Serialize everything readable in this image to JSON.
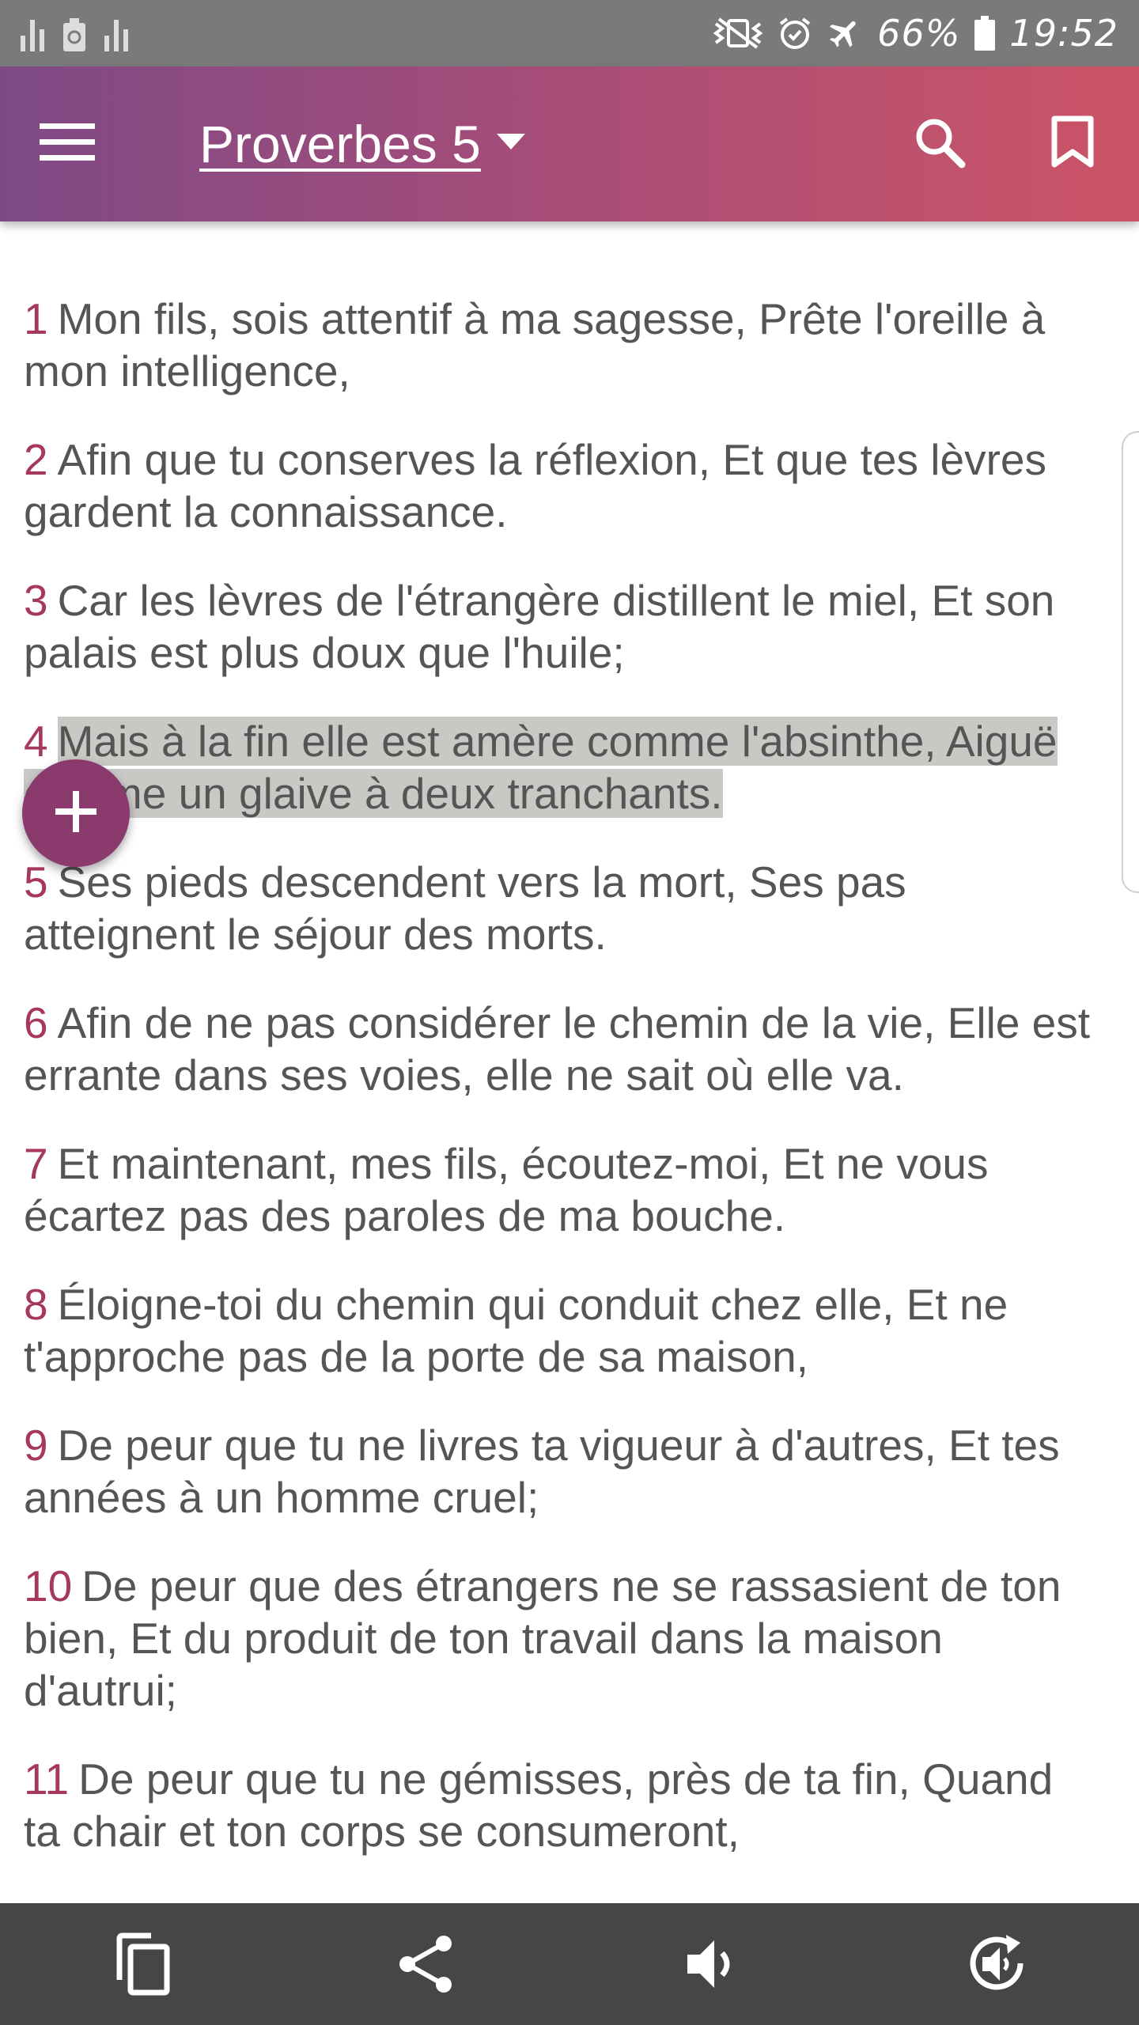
{
  "status_bar": {
    "battery_percent": "66%",
    "time": "19:52",
    "icons": [
      "signal-icon",
      "recycle-icon",
      "signal-icon",
      "vibrate-icon",
      "alarm-icon",
      "airplane-mode-icon",
      "battery-icon"
    ]
  },
  "app_bar": {
    "title": "Proverbes 5",
    "icons": [
      "menu-icon",
      "dropdown-arrow-icon",
      "search-icon",
      "bookmark-icon"
    ]
  },
  "verses": [
    {
      "number": "1",
      "text": "Mon fils, sois attentif à ma sagesse, Prête l'oreille à mon intelligence,"
    },
    {
      "number": "2",
      "text": "Afin que tu conserves la réflexion, Et que tes lèvres gardent la connaissance."
    },
    {
      "number": "3",
      "text": "Car les lèvres de l'étrangère distillent le miel, Et son palais est plus doux que l'huile;"
    },
    {
      "number": "4",
      "text": "Mais à la fin elle est amère comme l'absinthe, Aiguë comme un glaive à deux tranchants.",
      "highlighted": true
    },
    {
      "number": "5",
      "text": "Ses pieds descendent vers la mort, Ses pas atteignent le séjour des morts."
    },
    {
      "number": "6",
      "text": "Afin de ne pas considérer le chemin de la vie, Elle est errante dans ses voies, elle ne sait où elle va."
    },
    {
      "number": "7",
      "text": "Et maintenant, mes fils, écoutez-moi, Et ne vous écartez pas des paroles de ma bouche."
    },
    {
      "number": "8",
      "text": "Éloigne-toi du chemin qui conduit chez elle, Et ne t'approche pas de la porte de sa maison,"
    },
    {
      "number": "9",
      "text": "De peur que tu ne livres ta vigueur à d'autres, Et tes années à un homme cruel;"
    },
    {
      "number": "10",
      "text": "De peur que des étrangers ne se rassasient de ton bien, Et du produit de ton travail dans la maison d'autrui;"
    },
    {
      "number": "11",
      "text": "De peur que tu ne gémisses, près de ta fin, Quand ta chair et ton corps se consumeront,"
    }
  ],
  "fab": {
    "icon": "plus-icon"
  },
  "bottom_bar": {
    "actions": [
      "copy-icon",
      "share-icon",
      "speaker-icon",
      "replay-audio-icon"
    ]
  },
  "colors": {
    "status_bar": "#7a7a7a",
    "app_bar_start": "#7e4a86",
    "app_bar_end": "#cc5466",
    "verse_number": "#a6375f",
    "verse_text": "#555555",
    "highlight": "#c9c8c5",
    "fab": "#8b3a6e",
    "bottom_bar": "#464646"
  }
}
